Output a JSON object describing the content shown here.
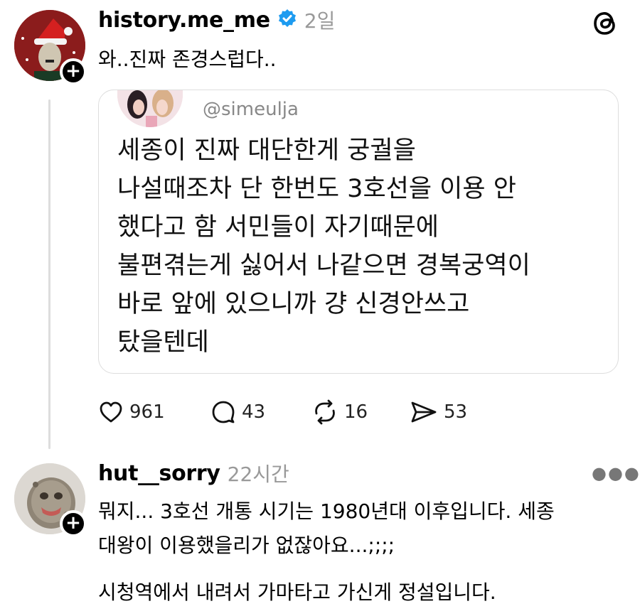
{
  "post": {
    "username": "history.me_me",
    "verified_icon": "verified-badge-icon",
    "time": "2일",
    "text": "와..진짜 존경스럽다..",
    "quote": {
      "handle": "@simeulja",
      "text": "세종이 진짜 대단한게 궁궐을\n나설때조차 단 한번도 3호선을 이용 안\n했다고 함 서민들이 자기때문에\n불편겪는게 싫어서 나같으면 경복궁역이\n바로 앞에 있으니까 걍 신경안쓰고\n탔을텐데"
    },
    "actions": {
      "likes": "961",
      "comments": "43",
      "reposts": "16",
      "shares": "53"
    }
  },
  "reply": {
    "username": "hut__sorry",
    "time": "22시간",
    "text_line1": "뭐지... 3호선 개통 시기는 1980년대 이후입니다. 세종",
    "text_line2": "대왕이 이용했을리가 없잖아요...;;;;",
    "text_line3": "시청역에서 내려서 가마타고 가신게 정설입니다."
  },
  "app_logo_icon": "threads-logo-icon",
  "colors": {
    "muted": "#999999",
    "verified": "#1d9bf0",
    "avatar1_bg": "#8b1c1c"
  }
}
